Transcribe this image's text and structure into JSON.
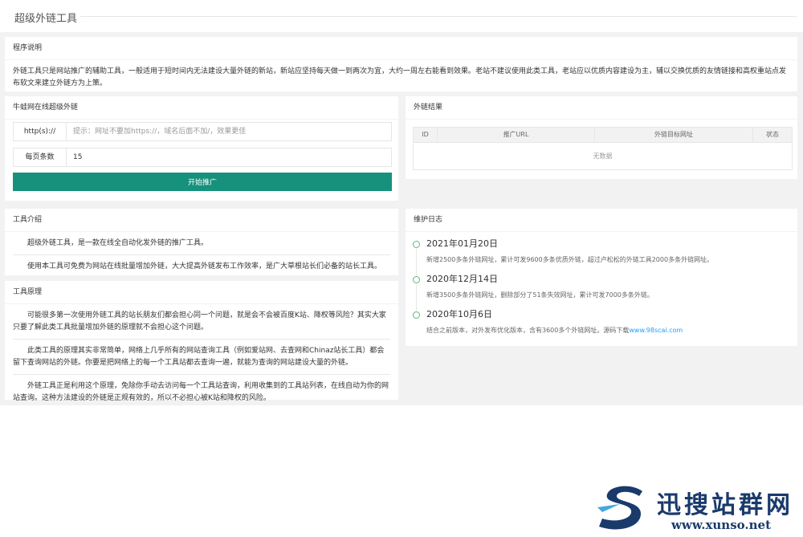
{
  "header": {
    "title": "超级外链工具"
  },
  "program_desc": {
    "title": "程序说明",
    "text": "外链工具只是网站推广的辅助工具，一般适用于短时间内无法建设大量外链的新站，新站应坚持每天做一到两次为宜，大约一周左右能看到效果。老站不建议使用此类工具，老站应以优质内容建设为主，辅以交换优质的友情链接和高权重站点发布软文来建立外链方为上策。"
  },
  "form_card": {
    "title": "牛蛙网在线超级外链",
    "url_label": "http(s)://",
    "url_placeholder": "提示：网址不要加https://，域名后面不加/，效果更佳",
    "per_page_label": "每页条数",
    "per_page_value": "15",
    "submit_label": "开始推广"
  },
  "result_card": {
    "title": "外链结果",
    "columns": [
      "ID",
      "推广URL",
      "外链目标网址",
      "状态"
    ],
    "empty_text": "无数据"
  },
  "tool_intro": {
    "title": "工具介绍",
    "items": [
      "超级外链工具，是一款在线全自动化发外链的推广工具。",
      "使用本工具可免费为网站在线批量增加外链，大大提高外链发布工作效率，是广大草根站长们必备的站长工具。"
    ]
  },
  "tool_principle": {
    "title": "工具原理",
    "items": [
      "可能很多第一次使用外链工具的站长朋友们都会担心同一个问题，就是会不会被百度K站、降权等风险？其实大家只要了解此类工具批量增加外链的原理就不会担心这个问题。",
      "此类工具的原理其实非常简单，网络上几乎所有的网站查询工具（例如爱站网、去查网和Chinaz站长工具）都会留下查询网站的外链。你要是把网络上的每一个工具站都去查询一遍，就能为查询的网站建设大量的外链。",
      "外链工具正是利用这个原理，免除你手动去访问每一个工具站查询，利用收集到的工具站列表，在线自动为你的网站查询。这种方法建设的外链是正规有效的，所以不必担心被K站和降权的风险。"
    ]
  },
  "changelog": {
    "title": "维护日志",
    "entries": [
      {
        "date": "2021年01月20日",
        "text": "新增2500多条外链网址，累计可发9600多条优质外链，超过卢松松的外链工具2000多条外链网址。"
      },
      {
        "date": "2020年12月14日",
        "text": "新增3500多条外链网址，删除部分了51条失效网址，累计可发7000多条外链。"
      },
      {
        "date": "2020年10月6日",
        "text": "结合之前版本，对外发布优化版本，含有3600多个外链网址。源码下载",
        "link": "www.98scai.com"
      }
    ]
  },
  "watermark": {
    "text": "迅搜站群网",
    "url": "www.xunso.net"
  },
  "colors": {
    "primary": "#16917b",
    "timeline_dot": "#5fb878",
    "link": "#1e9fff",
    "logo": "#1a3a6b"
  }
}
